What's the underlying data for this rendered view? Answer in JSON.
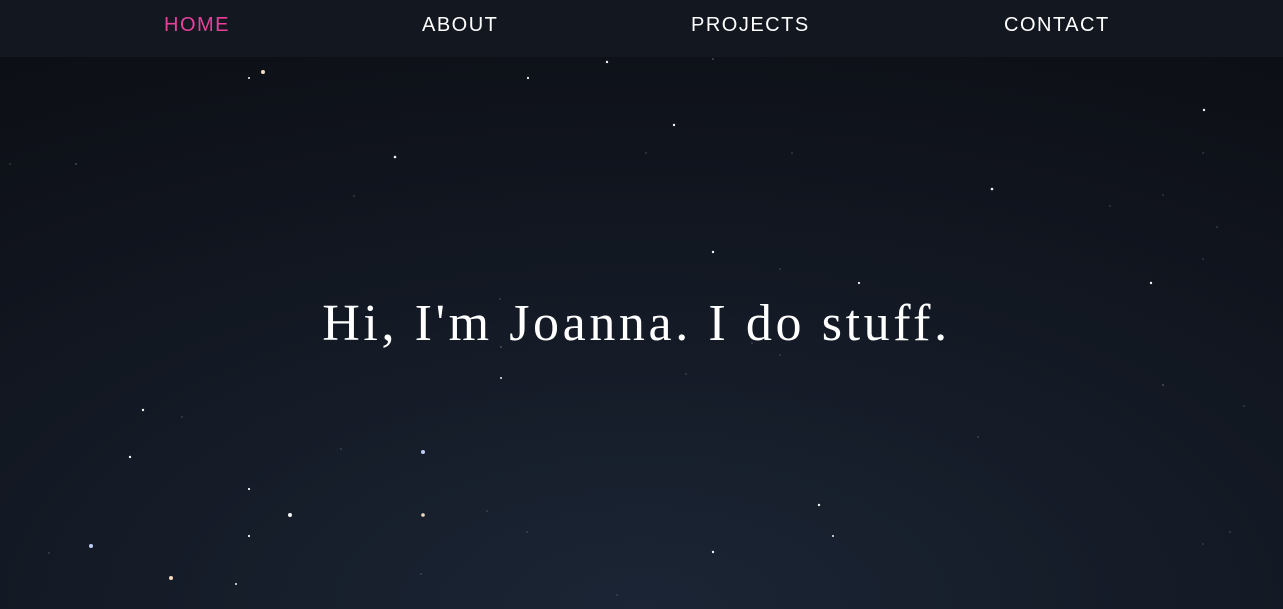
{
  "nav": {
    "items": [
      {
        "label": "HOME",
        "active": true
      },
      {
        "label": "ABOUT",
        "active": false
      },
      {
        "label": "PROJECTS",
        "active": false
      },
      {
        "label": "CONTACT",
        "active": false
      }
    ]
  },
  "hero": {
    "headline": "Hi, I'm Joanna. I do stuff."
  },
  "colors": {
    "accent": "#e8409a",
    "nav_background": "#121720",
    "page_background": "#0d1117",
    "text": "#ffffff",
    "star_warm": "#ffe6c4",
    "star_cool": "#c7d6ff"
  }
}
